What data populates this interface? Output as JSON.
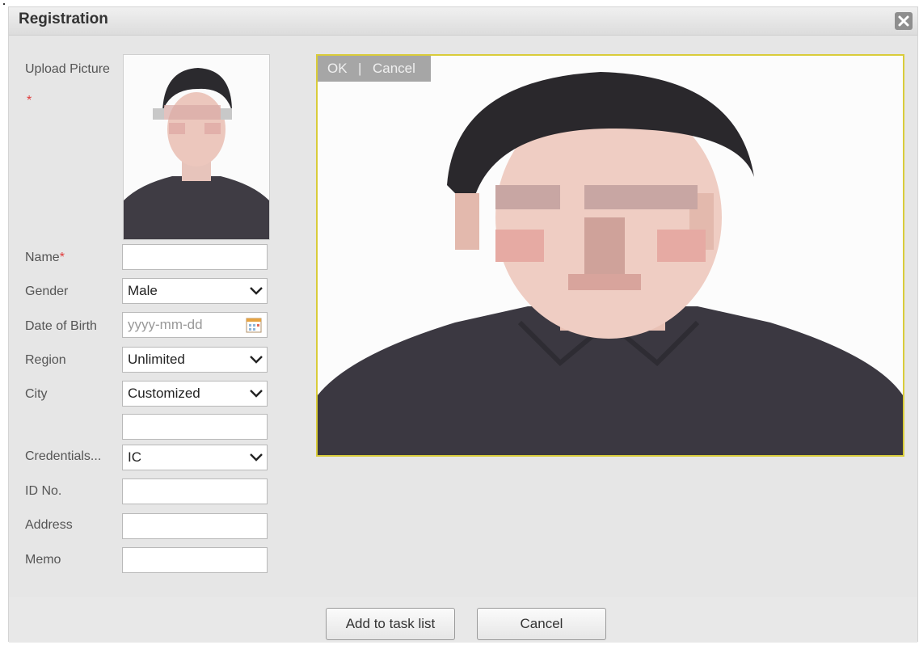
{
  "dialog": {
    "title": "Registration",
    "close_icon": "close-icon"
  },
  "form": {
    "upload_picture_label": "Upload Picture",
    "required_mark": "*",
    "name_label": "Name",
    "name_value": "",
    "gender_label": "Gender",
    "gender_value": "Male",
    "dob_label": "Date of Birth",
    "dob_placeholder": "yyyy-mm-dd",
    "region_label": "Region",
    "region_value": "Unlimited",
    "city_label": "City",
    "city_value": "Customized",
    "city_custom_value": "",
    "credentials_label": "Credentials...",
    "credentials_value": "IC",
    "id_label": "ID No.",
    "id_value": "",
    "address_label": "Address",
    "address_value": "",
    "memo_label": "Memo",
    "memo_value": ""
  },
  "crop": {
    "ok_label": "OK",
    "separator": "|",
    "cancel_label": "Cancel"
  },
  "footer": {
    "add_label": "Add to task list",
    "cancel_label": "Cancel"
  },
  "colors": {
    "required": "#e03c3c",
    "crop_border": "#d9cc3a",
    "dialog_bg": "#e6e6e6"
  }
}
